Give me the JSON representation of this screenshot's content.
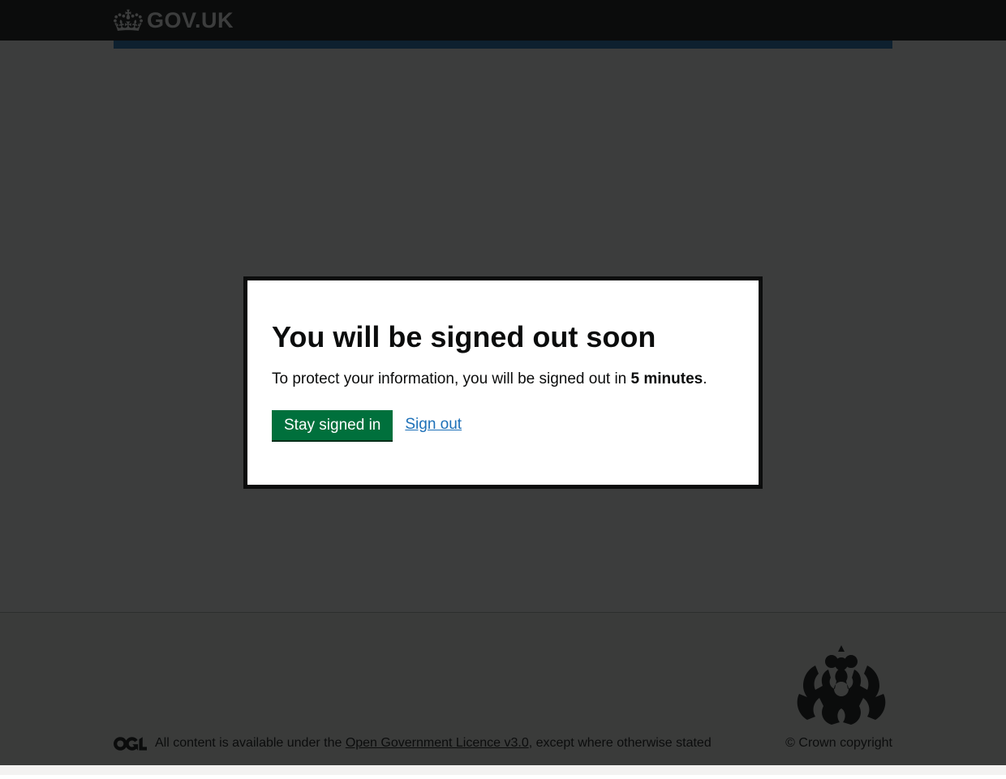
{
  "header": {
    "logo_text": "GOV.UK"
  },
  "modal": {
    "heading": "You will be signed out soon",
    "text_prefix": "To protect your information, you will be signed out in ",
    "text_time": "5 minutes",
    "text_suffix": ".",
    "stay_button": "Stay signed in",
    "signout_link": "Sign out"
  },
  "footer": {
    "text_prefix": "All content is available under the ",
    "licence_link": "Open Government Licence v3.0",
    "text_suffix": ", except where otherwise stated",
    "copyright": "© Crown copyright"
  }
}
